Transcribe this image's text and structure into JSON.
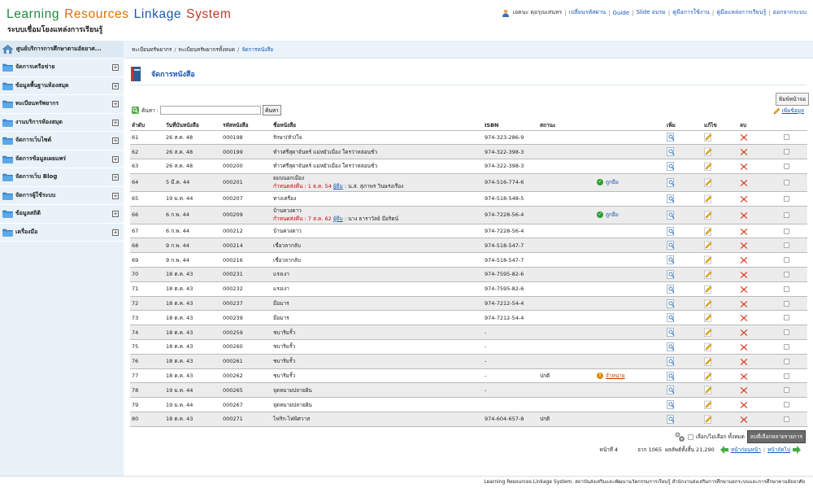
{
  "header": {
    "title_words": [
      {
        "text": "Learning",
        "color": "#1e8a3a"
      },
      {
        "text": "Resources",
        "color": "#e07000"
      },
      {
        "text": "Linkage",
        "color": "#1a55b3"
      },
      {
        "text": "System",
        "color": "#c0392b"
      }
    ],
    "subtitle": "ระบบเชื่อมโยงแหล่งการเรียนรู้",
    "user_name": "เอคนะ ดุอรุณเสนทร",
    "nav": [
      "เปลี่ยนรหัสผ่าน",
      "Guide",
      "Slide อบรม",
      "คู่มือการใช้งาน",
      "คู่มือแหล่งการเรียนรู้",
      "ออกจากระบบ"
    ]
  },
  "sidebar": {
    "top_label": "ศูนย์บริการการศึกษาตามอัธยาศ...",
    "items": [
      {
        "label": "จัดการเครือข่าย"
      },
      {
        "label": "ข้อมูลพื้นฐานห้องสมุด"
      },
      {
        "label": "ทะเบียนทรัพยากร"
      },
      {
        "label": "งานบริการห้องสมุด"
      },
      {
        "label": "จัดการเว็บไซต์"
      },
      {
        "label": "จัดการข้อมูลเผยแพร่"
      },
      {
        "label": "จัดการเว็บ Blog"
      },
      {
        "label": "จัดการผู้ใช้ระบบ"
      },
      {
        "label": "ข้อมูลสถิติ"
      },
      {
        "label": "เครื่องมือ"
      }
    ]
  },
  "breadcrumb": [
    "ทะเบียนทรัพยากร",
    "ทะเบียนทรัพยากรทั้งหมด",
    "จัดการหนังสือ"
  ],
  "page": {
    "title": "จัดการหนังสือ",
    "print_label": "พิมพ์หน้าจอ",
    "add_label": "เพิ่มข้อมูล",
    "search_label": "ค้นหา :",
    "search_value": "",
    "search_button": "ค้นหา"
  },
  "table": {
    "headers": [
      "ลำดับ",
      "วันที่บันทนังสือ",
      "รหัสหนังสือ",
      "ชื่อหนังสือ",
      "ISBN",
      "สถานะ",
      "",
      "เพิ่ม",
      "แก้ไข",
      "ลบ",
      ""
    ],
    "rows": [
      {
        "no": "61",
        "date": "26 ส.ค. 48",
        "code": "000198",
        "title": "รักษา(หัว)ใจ",
        "isbn": "974-323-286-9",
        "status": "",
        "note": "",
        "badge": ""
      },
      {
        "no": "62",
        "date": "26 ส.ค. 48",
        "code": "000199",
        "title": "ทำวศรีสุดาจันทร์ แม่หยัวเมือง ใครว่าหล่อนชั่ว",
        "isbn": "974-322-398-3",
        "status": "",
        "note": "",
        "badge": ""
      },
      {
        "no": "63",
        "date": "26 ส.ค. 48",
        "code": "000200",
        "title": "ทำวศรีสุดาจันทร์ แม่หยัวเมือง ใครว่าหล่อนชั่ว",
        "isbn": "974-322-398-3",
        "status": "",
        "note": "",
        "badge": ""
      },
      {
        "no": "64",
        "date": "5 มี.ค. 44",
        "code": "000201",
        "title": "ยมบนอกเมือง",
        "isbn": "974-516-774-6",
        "status": "",
        "note": {
          "due": "กำหนดส่งคืน : 1 ธ.ค. 54",
          "borrower_label": "ผู้ยืม",
          "borrower": ": น.ส. สุภาพร วินษร่งเรือง"
        },
        "badge": {
          "type": "borrow",
          "label": "ถูกยืม"
        }
      },
      {
        "no": "65",
        "date": "19 ม.ค. 44",
        "code": "000207",
        "title": "ทางเครือง",
        "isbn": "974-518-548-5",
        "status": "",
        "note": "",
        "badge": ""
      },
      {
        "no": "66",
        "date": "6 ก.พ. 44",
        "code": "000209",
        "title": "บ้านดวงดาว",
        "isbn": "974-7228-56-4",
        "status": "",
        "note": {
          "due": "กำหนดส่งคืน : 7 ส.ค. 62",
          "borrower_label": "ผู้ยืม",
          "borrower": ": นาง ธาราวัลย์ มีอริตน์"
        },
        "badge": {
          "type": "borrow",
          "label": "ถูกยืม"
        }
      },
      {
        "no": "67",
        "date": "6 ก.พ. 44",
        "code": "000212",
        "title": "บ้านดวงดาว",
        "isbn": "974-7228-56-4",
        "status": "",
        "note": "",
        "badge": ""
      },
      {
        "no": "68",
        "date": "9 ก.พ. 44",
        "code": "000214",
        "title": "เชื่อวลากลับ",
        "isbn": "974-518-547-7",
        "status": "",
        "note": "",
        "badge": ""
      },
      {
        "no": "69",
        "date": "9 ก.พ. 44",
        "code": "000216",
        "title": "เชื่อวลากลับ",
        "isbn": "974-518-547-7",
        "status": "",
        "note": "",
        "badge": ""
      },
      {
        "no": "70",
        "date": "18 ต.ค. 43",
        "code": "000231",
        "title": "แรงเงา",
        "isbn": "974-7595-82-6",
        "status": "",
        "note": "",
        "badge": ""
      },
      {
        "no": "71",
        "date": "18 ต.ค. 43",
        "code": "000232",
        "title": "แรงเงา",
        "isbn": "974-7595-82-6",
        "status": "",
        "note": "",
        "badge": ""
      },
      {
        "no": "72",
        "date": "18 ต.ค. 43",
        "code": "000237",
        "title": "มือมาร",
        "isbn": "974-7212-54-4",
        "status": "",
        "note": "",
        "badge": ""
      },
      {
        "no": "73",
        "date": "18 ต.ค. 43",
        "code": "000239",
        "title": "มือมาร",
        "isbn": "974-7212-54-4",
        "status": "",
        "note": "",
        "badge": ""
      },
      {
        "no": "74",
        "date": "18 ต.ค. 43",
        "code": "000259",
        "title": "ชบาริมรั้ว",
        "isbn": "-",
        "status": "",
        "note": "",
        "badge": ""
      },
      {
        "no": "75",
        "date": "18 ต.ค. 43",
        "code": "000260",
        "title": "ชบาริมรั้ว",
        "isbn": "-",
        "status": "",
        "note": "",
        "badge": ""
      },
      {
        "no": "76",
        "date": "18 ต.ค. 43",
        "code": "000261",
        "title": "ชบาริมรั้ว",
        "isbn": "-",
        "status": "",
        "note": "",
        "badge": ""
      },
      {
        "no": "77",
        "date": "18 ต.ค. 43",
        "code": "000262",
        "title": "ชบาริมรั้ว",
        "isbn": "-",
        "status": "ปกติ",
        "note": "",
        "badge": {
          "type": "dispose",
          "label": "จำหน่าย"
        }
      },
      {
        "no": "78",
        "date": "19 ม.ค. 44",
        "code": "000265",
        "title": "จุดหมายปลายฝัน",
        "isbn": "-",
        "status": "",
        "note": "",
        "badge": ""
      },
      {
        "no": "79",
        "date": "19 ม.ค. 44",
        "code": "000267",
        "title": "จุดหมายปลายฝัน",
        "isbn": "",
        "status": "",
        "note": "",
        "badge": ""
      },
      {
        "no": "80",
        "date": "18 ต.ค. 43",
        "code": "000271",
        "title": "ไฟรัก-ไฟพิศวาส",
        "isbn": "974-604-657-8",
        "status": "ปกติ",
        "note": "",
        "badge": ""
      }
    ]
  },
  "bulk": {
    "select_label": "เลือก/ไม่เลือก ทั้งหมด",
    "delete_label": "ลบที่เลือกหลายรายการ"
  },
  "pager": {
    "page_label": "หน้าที่",
    "page_value": "4",
    "of_text": "จาก 1065",
    "total_text": "ผลลัพธ์ทั้งสิ้น 21,290",
    "prev_label": "หน้าก่อนหน้า",
    "next_label": "หน้าถัดไป"
  },
  "footer": {
    "text": "Learning Resources Linkage System. สถาบันส่งเสริมและพัฒนานวัตกรรมการเรียนรู้ สำนักงานส่งเสริมการศึกษานอกระบบและการศึกษาตามอัธยาศัย"
  },
  "colors": {
    "accent": "#1a55b3",
    "sidebar_bg": "#e8f2f8",
    "alt_row": "#ececec",
    "delete_red": "#d93a1f"
  }
}
